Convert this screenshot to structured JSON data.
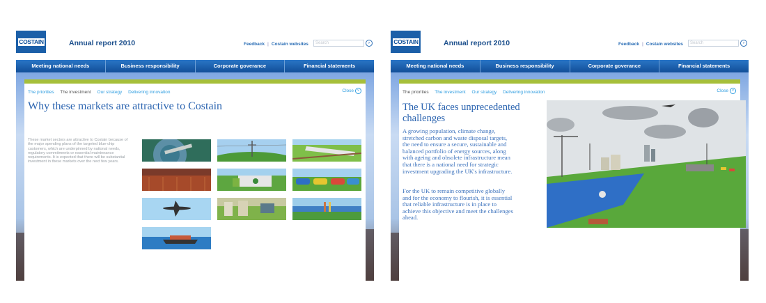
{
  "header": {
    "logo_text": "COSTAIN",
    "title": "Annual report 2010",
    "links": [
      "Feedback",
      "Costain websites"
    ],
    "search_placeholder": "Search"
  },
  "nav": [
    "Meeting national needs",
    "Business responsibility",
    "Corporate goverance",
    "Financial statements"
  ],
  "left": {
    "subnav": [
      "The priorities",
      "The investment",
      "Our strategy",
      "Delivering innovation"
    ],
    "active_subnav": "The investment",
    "close": "Close",
    "heading": "Why these markets are attractive to Costain",
    "body": "These market sectors are attractive to Costain because of the major spending plans of the targeted blue-chip customers, which are underpinned by national needs, regulatory commitments or essential maintenance requirements. It is expected that there will be substantial investment in these markets over the next few years.",
    "thumbnails": [
      "water-treatment",
      "power-pylon",
      "high-speed-train",
      "nuclear",
      "waste-truck",
      "cars-traffic",
      "aircraft",
      "energy-plant",
      "coastal-walkers",
      "cargo-ship"
    ]
  },
  "right": {
    "subnav": [
      "The priorities",
      "The investment",
      "Our strategy",
      "Delivering innovation"
    ],
    "active_subnav": "The priorities",
    "close": "Close",
    "heading": "The UK faces unprecedented challenges",
    "body1": "A growing population, climate change, stretched carbon and waste disposal targets, the need to ensure a secure, sustainable and balanced portfolio of energy sources, along with ageing and obsolete infrastructure mean that there is a national need for strategic investment upgrading the UK's infrastructure.",
    "body2": "For the UK to remain competitive globally and for the economy to flourish, it is essential that reliable infrastructure is in place to achieve this objective and meet the challenges ahead."
  },
  "colors": {
    "brand_blue": "#1b5fa8",
    "nav_blue": "#1a5fae",
    "accent_green": "#a6bf3a",
    "link_blue": "#2f9de0"
  }
}
